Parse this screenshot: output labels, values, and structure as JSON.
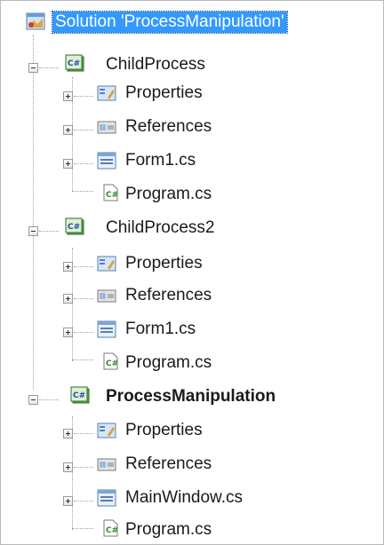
{
  "solution": {
    "label": "Solution 'ProcessManipulation'"
  },
  "projects": [
    {
      "name": "ChildProcess",
      "items": [
        "Properties",
        "References",
        "Form1.cs",
        "Program.cs"
      ]
    },
    {
      "name": "ChildProcess2",
      "items": [
        "Properties",
        "References",
        "Form1.cs",
        "Program.cs"
      ]
    },
    {
      "name": "ProcessManipulation",
      "bold": true,
      "items": [
        "Properties",
        "References",
        "MainWindow.cs",
        "Program.cs"
      ]
    }
  ],
  "icons": {
    "solution": "solution-icon",
    "project": "csharp-project-icon",
    "properties": "properties-icon",
    "references": "references-icon",
    "form": "form-icon",
    "code": "csharp-file-icon"
  },
  "colors": {
    "selection": "#3399ff",
    "tree_lines": "#a0a0a0"
  }
}
